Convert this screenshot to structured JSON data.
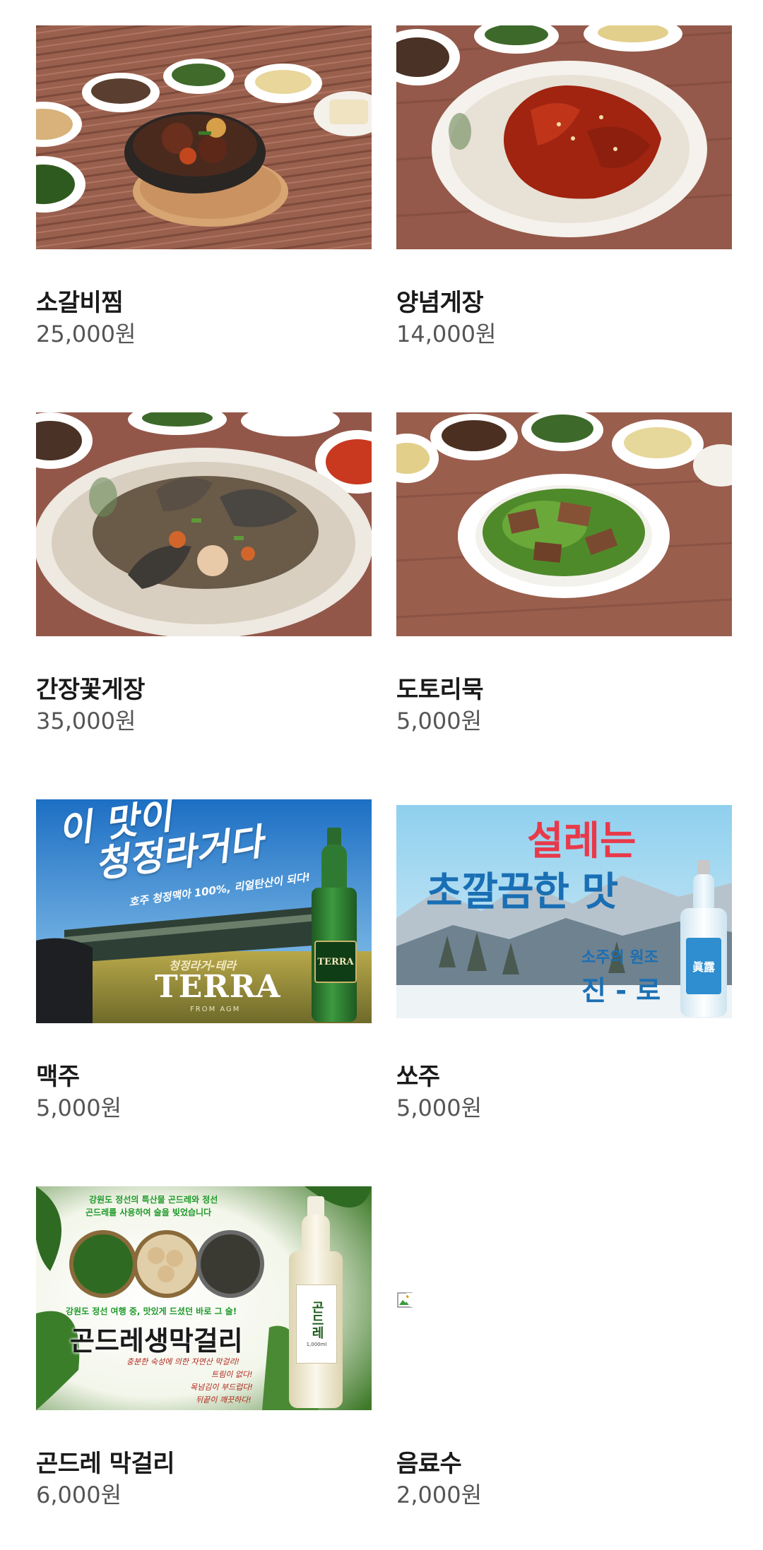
{
  "menu": [
    {
      "name": "소갈비찜",
      "price": "25,000원",
      "image": "braised-short-rib-photo"
    },
    {
      "name": "양념게장",
      "price": "14,000원",
      "image": "spicy-marinated-crab-photo"
    },
    {
      "name": "간장꽃게장",
      "price": "35,000원",
      "image": "soy-marinated-crab-photo"
    },
    {
      "name": "도토리묵",
      "price": "5,000원",
      "image": "acorn-jelly-salad-photo"
    },
    {
      "name": "맥주",
      "price": "5,000원",
      "image": "terra-beer-ad",
      "ad_text": {
        "headline_1": "이 맛이",
        "headline_2": "청정라거다",
        "sub": "호주 청정맥아 100%, 리얼탄산이 되다!",
        "caption": "청정라거-테라",
        "brand": "TERRA",
        "from": "FROM AGM",
        "bottle_label": "TERRA"
      }
    },
    {
      "name": "쏘주",
      "price": "5,000원",
      "image": "jinro-soju-ad",
      "ad_text": {
        "headline_1": "설레는",
        "headline_2": "초깔끔한 맛",
        "sub": "소주의 원조",
        "brand": "진 - 로",
        "bottle_label": "眞露"
      }
    },
    {
      "name": "곤드레 막걸리",
      "price": "6,000원",
      "image": "gondre-makgeolli-ad",
      "ad_text": {
        "top_1": "강원도 정선의 특산물 곤드레와 정선",
        "top_2": "곤드레를 사용하여 술을 빚었습니다",
        "mid": "강원도 정선 여행 중, 맛있게 드셨던 바로 그 술!",
        "title": "곤드레생막걸리",
        "line_1": "충분한 숙성에 의한 자연산 막걸리!",
        "line_2": "트림이 없다!",
        "line_3": "목넘김이 부드럽다!",
        "line_4": "뒤끝이 깨끗하다!",
        "bottle_label": "곤드레",
        "bottle_sub": "1,000ml"
      }
    },
    {
      "name": "음료수",
      "price": "2,000원",
      "image": "broken-image"
    }
  ],
  "colors": {
    "name_text": "#1a1a1a",
    "price_text": "#555555",
    "background": "#ffffff"
  }
}
